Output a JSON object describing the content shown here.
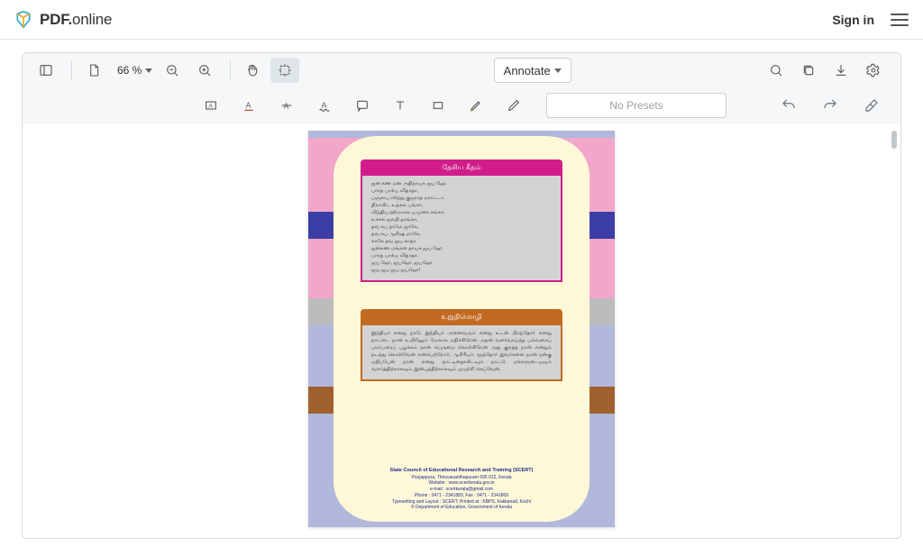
{
  "header": {
    "brand_primary": "PDF.",
    "brand_secondary": "online",
    "sign_in": "Sign in"
  },
  "toolbar": {
    "zoom_percent": "66 %",
    "annotate_label": "Annotate",
    "no_presets": "No Presets"
  },
  "document": {
    "box1": {
      "title": "தேசிய கீதம்",
      "lines": [
        "ஜன கண மன அதிநாயக ஜய ஹே",
        "பாரத பாக்ய விதாதா,",
        "பஞ்சாப ஸிந்து குஜராத மராட்டா",
        "திராவிட உத்கல பங்கா,",
        "விந்திய ஹிமாசல யமுனா கங்கா,",
        "உச்சல ஜலதி தரங்கா,",
        "தவ சுப நாமே ஜாகே,",
        "தவ சுப ஆசிஷ மாகே,",
        "காகே தவ ஜய காதா",
        "ஜனகண மங்கள தாயக ஜய ஹே",
        "பாரத பாக்ய விதாதா,",
        "ஜய ஹே, ஜயஹே, ஜயஹே",
        "ஜய ஜய ஜய ஜயஹே!"
      ]
    },
    "box2": {
      "title": "உறுதிமொழி",
      "body": "இந்தியா எனது நாடு. இந்தியர் அனைவரும் எனது உடன் பிறந்தோர் எனது நாட்டை நான் உயிரினும் மேலாக மதிக்கிறேன் அதன் வளர்வாய்ந்த பல்வகைப் பரம்பரைப் பழக்கம் நான் பெருமை கொள்கிறேன் அது குறத்த நான் என்றும் நடந்து கொள்வேன் என்பெற்றோர், ஆசிரியர், மூத்தோர் இவர்களை நான் நன்கு மதிப்பேன் நான் எனது நாட்டினதாகிடவும் நாட்டு மக்களுடையவும் வளர்த்திற்காகவும், இன்பத்திற்காகவும் முயற்சி செய்வேன்."
    },
    "footer": {
      "org": "State Council of Educational Research and Training (SCERT)",
      "addr": "Poojappura, Thiruvananthapuram 695 012, Kerala",
      "web": "Website : www.scertkerala.gov.in",
      "email": "e-mail : scertkerala@gmail.com",
      "phone": "Phone : 0471 - 2341883, Fax : 0471 - 2341869",
      "print": "Typesetting and Layout : SCERT; Printed at : KBPS, Kakkanad, Kochi",
      "dept": "© Department of Education, Government of Kerala"
    }
  }
}
